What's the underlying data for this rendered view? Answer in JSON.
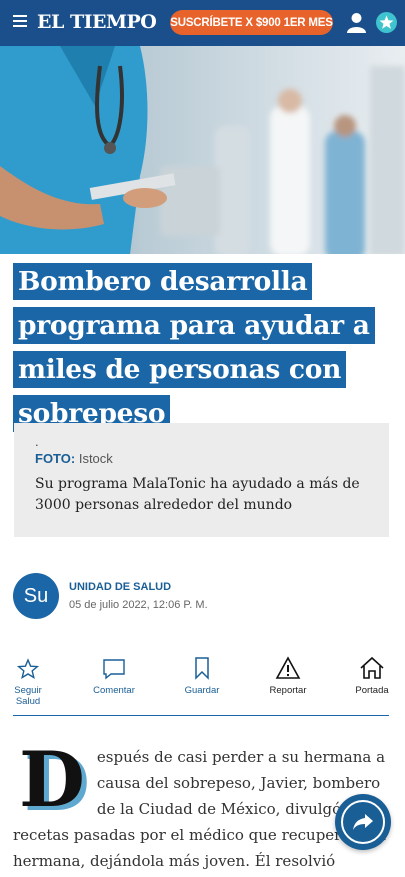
{
  "header": {
    "logo": "EL TIEMPO",
    "subscribe_label": "SUSCRÍBETE X $900 1ER MES",
    "icons": [
      "menu-icon",
      "user-icon",
      "star-badge-icon"
    ],
    "colors": {
      "bar": "#1a4f8b",
      "subscribe": "#e8632b",
      "badge": "#3ec3cf"
    }
  },
  "hero": {
    "image": "doctor-holding-tablet-hospital-photo"
  },
  "article": {
    "title_lines": [
      "Bombero desarrolla",
      "programa para ayudar a",
      "miles de personas con",
      "sobrepeso"
    ],
    "caption_dot": ".",
    "photo_label": "FOTO:",
    "photo_credit": "Istock",
    "subtitle": "Su programa MalaTonic ha ayudado a más de 3000 personas alrededor del mundo",
    "author": "UNIDAD DE SALUD",
    "avatar_initials": "Su",
    "date": "05 de julio 2022, 12:06 P. M.",
    "dropcap": "D",
    "body": "espués de casi perder a su hermana a causa del sobrepeso, Javier, bombero de la Ciudad de México, divulgó las recetas pasadas por el médico que recuperó a su hermana, dejándola más joven. Él resolvió compartir con"
  },
  "actions": [
    {
      "label": "Seguir Salud",
      "icon": "star-outline-icon"
    },
    {
      "label": "Comentar",
      "icon": "comment-icon"
    },
    {
      "label": "Guardar",
      "icon": "bookmark-icon"
    },
    {
      "label": "Reportar",
      "icon": "warning-icon"
    },
    {
      "label": "Portada",
      "icon": "home-icon"
    }
  ],
  "accent": "#1a66a7"
}
